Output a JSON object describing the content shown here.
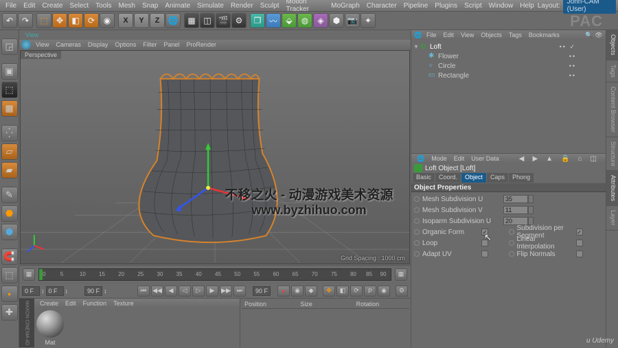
{
  "menubar": [
    "File",
    "Edit",
    "Create",
    "Select",
    "Tools",
    "Mesh",
    "Snap",
    "Animate",
    "Simulate",
    "Render",
    "Sculpt",
    "Motion Tracker",
    "MoGraph",
    "Character",
    "Pipeline",
    "Plugins",
    "Script",
    "Window",
    "Help"
  ],
  "layout_label": "Layout:",
  "layout_value": "John-CAM (User)",
  "view_tab": "View",
  "view_menu": [
    "View",
    "Cameras",
    "Display",
    "Options",
    "Filter",
    "Panel",
    "ProRender"
  ],
  "axes": [
    "X",
    "Y",
    "Z"
  ],
  "perspective": "Perspective",
  "grid_spacing": "Grid Spacing : 1000 cm",
  "ruler_ticks": [
    "0",
    "5",
    "10",
    "15",
    "20",
    "25",
    "30",
    "35",
    "40",
    "45",
    "50",
    "55",
    "60",
    "65",
    "70",
    "75",
    "80",
    "85",
    "90"
  ],
  "playbar": {
    "f_start": "0 F",
    "f_current": "0 F",
    "f_end": "90 F",
    "f_total": "90 F"
  },
  "materials_menu": [
    "Create",
    "Edit",
    "Function",
    "Texture"
  ],
  "mat_name": "Mat",
  "obj_menu": [
    "File",
    "Edit",
    "View",
    "Objects",
    "Tags",
    "Bookmarks"
  ],
  "tree": [
    {
      "name": "Loft",
      "indent": 0,
      "selected": true,
      "icon": "loft",
      "color": "#3a9a3a"
    },
    {
      "name": "Flower",
      "indent": 1,
      "selected": false,
      "icon": "spline",
      "color": "#6ab8d8"
    },
    {
      "name": "Circle",
      "indent": 1,
      "selected": false,
      "icon": "spline",
      "color": "#6ab8d8"
    },
    {
      "name": "Rectangle",
      "indent": 1,
      "selected": false,
      "icon": "spline",
      "color": "#6ab8d8"
    }
  ],
  "attr_menu": [
    "Mode",
    "Edit",
    "User Data"
  ],
  "attr_title": "Loft Object [Loft]",
  "attr_tabs": [
    "Basic",
    "Coord.",
    "Object",
    "Caps",
    "Phong"
  ],
  "attr_active_tab": 2,
  "attr_section": "Object Properties",
  "props": {
    "mesh_u_label": "Mesh Subdivision U",
    "mesh_u_value": "35",
    "mesh_v_label": "Mesh Subdivision V",
    "mesh_v_value": "11",
    "iso_u_label": "Isoparm Subdivision U",
    "iso_u_value": "20",
    "organic_label": "Organic Form",
    "organic_checked": true,
    "subdiv_seg_label": "Subdivision per Segment",
    "subdiv_seg_checked": true,
    "loop_label": "Loop",
    "loop_checked": false,
    "linear_label": "Linear Interpolation",
    "linear_checked": false,
    "adapt_label": "Adapt UV",
    "adapt_checked": false,
    "flip_label": "Flip Normals",
    "flip_checked": false
  },
  "coord_headers": [
    "Position",
    "Size",
    "Rotation"
  ],
  "side_tabs": [
    "Objects",
    "Tags",
    "Content Browser",
    "Structure",
    "Attributes",
    "Layer"
  ],
  "watermark_line1": "不移之火 - 动漫游戏美术资源",
  "watermark_line2": "www.byzhihuo.com",
  "watermark_top": "PAC",
  "watermark_corner": "u Udemy"
}
